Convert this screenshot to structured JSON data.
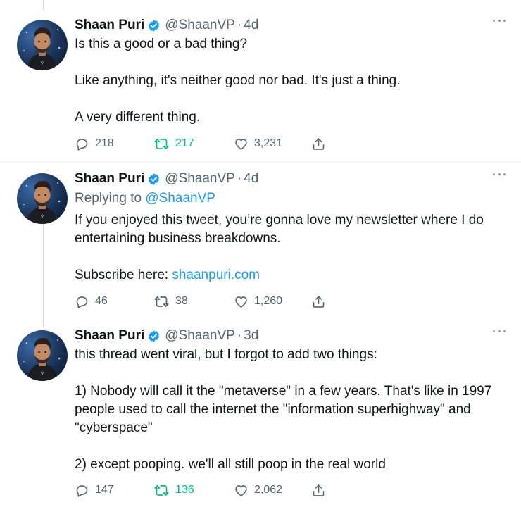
{
  "tweets": [
    {
      "author": "Shaan Puri",
      "handle": "@ShaanVP",
      "separator": "·",
      "time": "4d",
      "replying": null,
      "paragraphs": [
        "Is this a good or a bad thing?",
        "Like anything, it's neither good nor bad. It's just a thing.",
        "A very different thing."
      ],
      "link": null,
      "stats": {
        "replies": "218",
        "retweets": "217",
        "likes": "3,231"
      },
      "retweeted": true
    },
    {
      "author": "Shaan Puri",
      "handle": "@ShaanVP",
      "separator": "·",
      "time": "4d",
      "replying": {
        "prefix": "Replying to ",
        "mention": "@ShaanVP"
      },
      "paragraphs": [
        "If you enjoyed this tweet, you’re gonna love my newsletter where I do\nentertaining business breakdowns.",
        "Subscribe here: "
      ],
      "link": "shaanpuri.com",
      "stats": {
        "replies": "46",
        "retweets": "38",
        "likes": "1,260"
      },
      "retweeted": false
    },
    {
      "author": "Shaan Puri",
      "handle": "@ShaanVP",
      "separator": "·",
      "time": "3d",
      "replying": null,
      "paragraphs": [
        "this thread went viral, but I forgot to add two things:",
        "1) Nobody will call it the \"metaverse\" in a few years. That's like in 1997\npeople used to call the internet the \"information superhighway\" and\n\"cyberspace\"",
        "2) except pooping. we'll all still poop in the real world"
      ],
      "link": null,
      "stats": {
        "replies": "147",
        "retweets": "136",
        "likes": "2,062"
      },
      "retweeted": true
    }
  ],
  "colors": {
    "accent": "#1d9bf0",
    "retweet_active": "#00ba7c",
    "secondary_text": "#536471",
    "thread_line": "#cfd9de"
  },
  "icons": {
    "verified": "verified-badge-icon",
    "more": "more-options-icon",
    "reply": "reply-icon",
    "retweet": "retweet-icon",
    "like": "like-heart-icon",
    "share": "share-icon"
  }
}
